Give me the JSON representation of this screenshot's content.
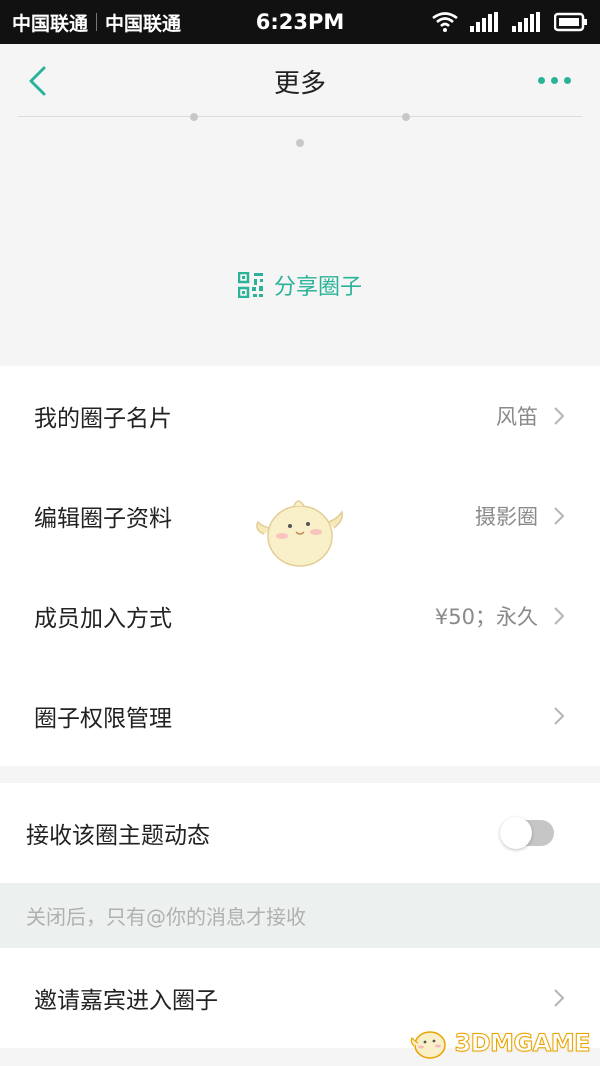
{
  "status_bar": {
    "carrier_1": "中国联通",
    "carrier_2": "中国联通",
    "time": "6:23PM"
  },
  "header": {
    "title": "更多",
    "back_icon": "chevron-left-icon",
    "more_icon": "more-dots-icon"
  },
  "hero": {
    "share_label": "分享圈子",
    "share_icon": "qr-code-icon"
  },
  "menu": {
    "items": [
      {
        "label": "我的圈子名片",
        "value": "风笛"
      },
      {
        "label": "编辑圈子资料",
        "value": "摄影圈"
      },
      {
        "label": "成员加入方式",
        "value": "¥50；永久"
      },
      {
        "label": "圈子权限管理",
        "value": ""
      }
    ]
  },
  "notify": {
    "label": "接收该圈主题动态",
    "enabled": false,
    "hint": "关闭后，只有@你的消息才接收"
  },
  "invite": {
    "label": "邀请嘉宾进入圈子"
  },
  "watermark": {
    "text": "3DMGAME"
  },
  "colors": {
    "accent": "#2bb39a",
    "background": "#f5f5f5",
    "hint_bg": "#ecf0ef"
  }
}
